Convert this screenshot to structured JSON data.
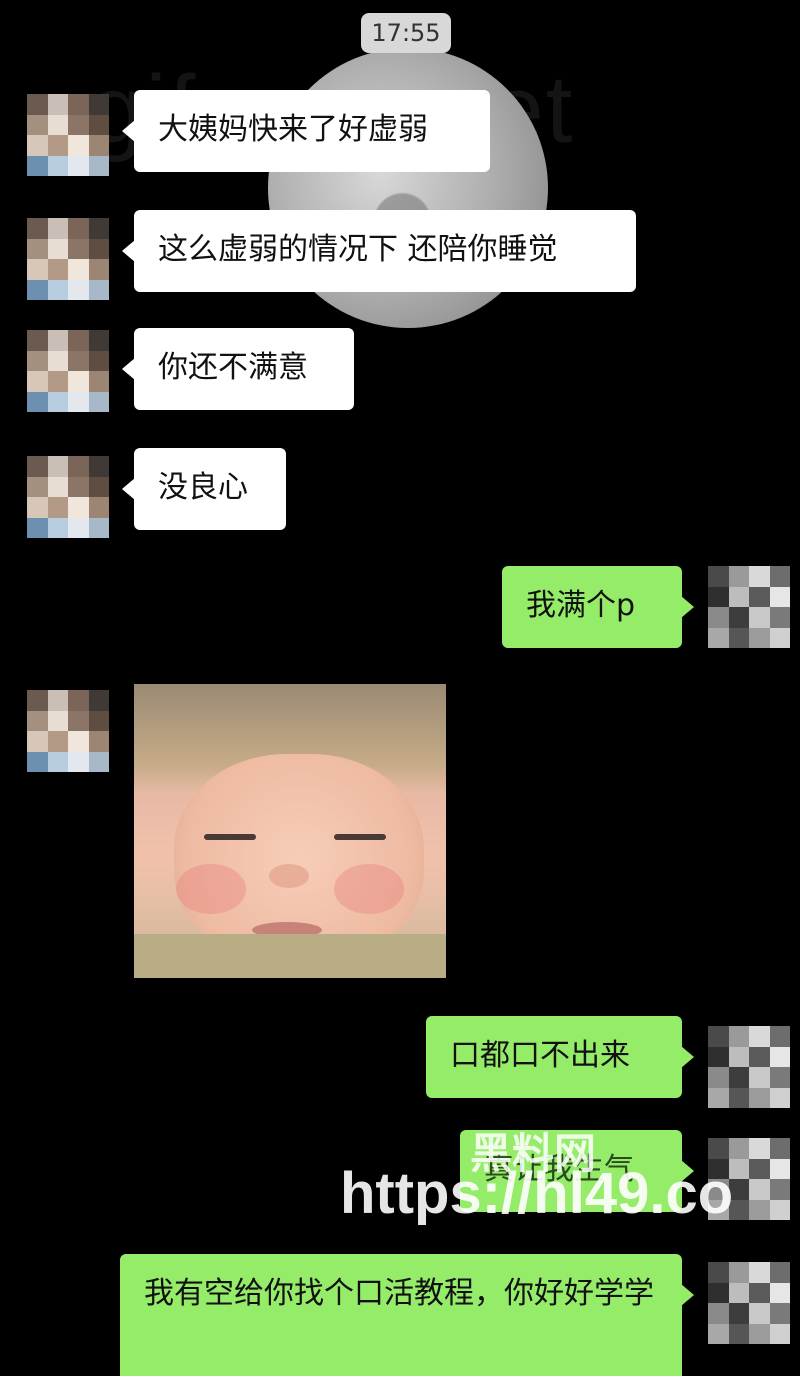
{
  "status_time": "17:55",
  "watermark_bg": "gifem   y.net",
  "messages": [
    {
      "side": "left",
      "text": "大姨妈快来了好虚弱"
    },
    {
      "side": "left",
      "text": "这么虚弱的情况下 还陪你睡觉"
    },
    {
      "side": "left",
      "text": "你还不满意"
    },
    {
      "side": "left",
      "text": "没良心"
    },
    {
      "side": "right",
      "text": "我满个p"
    },
    {
      "side": "left",
      "type": "image",
      "description": "sleepy-baby-sticker"
    },
    {
      "side": "right",
      "text": "口都口不出来"
    },
    {
      "side": "right",
      "text": "真让我生气"
    },
    {
      "side": "right",
      "text": "我有空给你找个口活教程，你好好学学"
    }
  ],
  "overlay_watermark": {
    "line1": "黑料网",
    "line2": "https://hl49.co"
  },
  "colors": {
    "background": "#000000",
    "bubble_left": "#ffffff",
    "bubble_right": "#95ec69",
    "time_badge": "#d8d8d8"
  }
}
